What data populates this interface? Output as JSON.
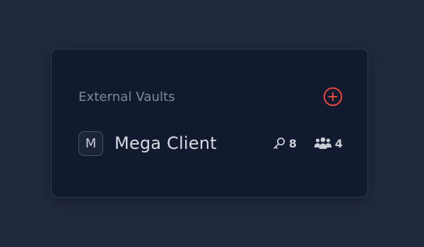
{
  "panel": {
    "title": "External Vaults",
    "add_icon": "plus-circle-icon",
    "accent_color": "#e8473b"
  },
  "vaults": [
    {
      "avatar_letter": "M",
      "name": "Mega Client",
      "keys_icon": "key-icon",
      "keys_count": "8",
      "members_icon": "users-icon",
      "members_count": "4"
    }
  ]
}
